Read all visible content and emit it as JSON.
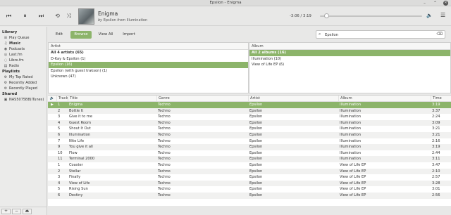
{
  "window": {
    "title": "Epsilon - Enigma"
  },
  "player": {
    "title": "Enigma",
    "by_word": "by",
    "artist": "Epsilon",
    "from_word": "from",
    "album": "Illumination",
    "time": "-3:06 / 3:19",
    "progress_fraction": 0.065
  },
  "sidebar": {
    "library_heading": "Library",
    "library_items": [
      {
        "label": "Play Queue",
        "icon": "queue-icon"
      },
      {
        "label": "Music",
        "icon": "music-icon",
        "selected": true
      },
      {
        "label": "Podcasts",
        "icon": "podcast-icon"
      },
      {
        "label": "Last.fm",
        "icon": "lastfm-icon"
      },
      {
        "label": "Libre.fm",
        "icon": "librefm-icon"
      },
      {
        "label": "Radio",
        "icon": "radio-icon"
      }
    ],
    "playlists_heading": "Playlists",
    "playlist_items": [
      {
        "label": "My Top Rated",
        "icon": "gear-icon"
      },
      {
        "label": "Recently Added",
        "icon": "gear-icon"
      },
      {
        "label": "Recently Played",
        "icon": "gear-icon"
      }
    ],
    "shared_heading": "Shared",
    "shared_items": [
      {
        "label": "NAS5075B8(iTunes)",
        "icon": "share-icon"
      }
    ],
    "bottom_buttons": [
      "+",
      "−",
      "⏏"
    ]
  },
  "toolbar": {
    "tabs": [
      "Edit",
      "Browse",
      "View All",
      "Import"
    ],
    "active_tab": "Browse",
    "search_value": "Epsilon"
  },
  "artist_pane": {
    "header": "Artist",
    "rows": [
      {
        "label": "All 4 artists (65)",
        "bold": true
      },
      {
        "label": "D-Kay & Epsilon (1)"
      },
      {
        "label": "Epsilon (16)",
        "selected": true
      },
      {
        "label": "Epsilon (with guest trakson) (1)"
      },
      {
        "label": "Unknown (47)"
      }
    ]
  },
  "album_pane": {
    "header": "Album",
    "rows": [
      {
        "label": "All 2 albums (16)",
        "selected": true,
        "bold": true
      },
      {
        "label": "Illumination (10)"
      },
      {
        "label": "View of Life EP (6)"
      }
    ]
  },
  "tracklist": {
    "headers": {
      "track": "Track",
      "title": "Title",
      "genre": "Genre",
      "artist": "Artist",
      "album": "Album",
      "time": "Time"
    },
    "rows": [
      {
        "track": "1",
        "title": "Enigma",
        "genre": "Techno",
        "artist": "Epsilon",
        "album": "Illumination",
        "time": "3:19",
        "playing": true
      },
      {
        "track": "2",
        "title": "Bottle It",
        "genre": "Techno",
        "artist": "Epsilon",
        "album": "Illumination",
        "time": "3:37"
      },
      {
        "track": "3",
        "title": "Give it to me",
        "genre": "Techno",
        "artist": "Epsilon",
        "album": "Illumination",
        "time": "2:24"
      },
      {
        "track": "4",
        "title": "Guest Room",
        "genre": "Techno",
        "artist": "Epsilon",
        "album": "Illumination",
        "time": "3:09"
      },
      {
        "track": "5",
        "title": "Shout It Out",
        "genre": "Techno",
        "artist": "Epsilon",
        "album": "Illumination",
        "time": "3:21"
      },
      {
        "track": "6",
        "title": "Illumination",
        "genre": "Techno",
        "artist": "Epsilon",
        "album": "Illumination",
        "time": "3:21"
      },
      {
        "track": "7",
        "title": "Nite Life",
        "genre": "Techno",
        "artist": "Epsilon",
        "album": "Illumination",
        "time": "2:16"
      },
      {
        "track": "9",
        "title": "You give it all",
        "genre": "Techno",
        "artist": "Epsilon",
        "album": "Illumination",
        "time": "3:19"
      },
      {
        "track": "10",
        "title": "Flow",
        "genre": "Techno",
        "artist": "Epsilon",
        "album": "Illumination",
        "time": "2:44"
      },
      {
        "track": "11",
        "title": "Terminal 2000",
        "genre": "Techno",
        "artist": "Epsilon",
        "album": "Illumination",
        "time": "3:11"
      },
      {
        "track": "1",
        "title": "Coaster",
        "genre": "Techno",
        "artist": "Epsilon",
        "album": "View of Life EP",
        "time": "3:47"
      },
      {
        "track": "2",
        "title": "Stellar",
        "genre": "Techno",
        "artist": "Epsilon",
        "album": "View of Life EP",
        "time": "2:10"
      },
      {
        "track": "3",
        "title": "Finally",
        "genre": "Techno",
        "artist": "Epsilon",
        "album": "View of Life EP",
        "time": "2:57"
      },
      {
        "track": "4",
        "title": "View of Life",
        "genre": "Techno",
        "artist": "Epsilon",
        "album": "View of Life EP",
        "time": "3:28"
      },
      {
        "track": "5",
        "title": "Rising Sun",
        "genre": "Techno",
        "artist": "Epsilon",
        "album": "View of Life EP",
        "time": "3:01"
      },
      {
        "track": "6",
        "title": "Destiny",
        "genre": "Techno",
        "artist": "Epsilon",
        "album": "View of Life EP",
        "time": "2:56"
      }
    ]
  },
  "colors": {
    "accent": "#8cb46a",
    "background": "#e8e8e7"
  }
}
